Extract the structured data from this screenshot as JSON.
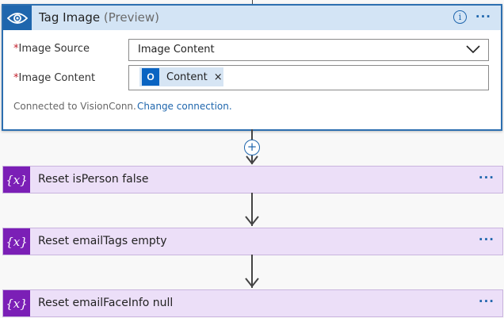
{
  "tag_image": {
    "title": "Tag Image",
    "title_suffix": "(Preview)",
    "image_source_label": "Image Source",
    "image_source_value": "Image Content",
    "image_content_label": "Image Content",
    "image_content_token": "Content",
    "required_mark": "*",
    "token_remove": "×",
    "connected_text": "Connected to VisionConn.",
    "change_connection": "Change connection.",
    "info_icon": "i",
    "more": "···"
  },
  "variables": [
    {
      "title": "Reset isPerson false",
      "icon_text": "{x}",
      "more": "···"
    },
    {
      "title": "Reset emailTags empty",
      "icon_text": "{x}",
      "more": "···"
    },
    {
      "title": "Reset emailFaceInfo null",
      "icon_text": "{x}",
      "more": "···"
    }
  ],
  "add_step": "+",
  "colors": {
    "header_bg": "#d3e4f5",
    "accent_blue": "#1f66ad",
    "variable_purple": "#7b1fb6",
    "variable_bg": "#ecdff8",
    "required_red": "#c2202d"
  },
  "icons": {
    "tag_image": "eye-icon",
    "outlook": "outlook-icon",
    "variable": "variable-icon"
  }
}
